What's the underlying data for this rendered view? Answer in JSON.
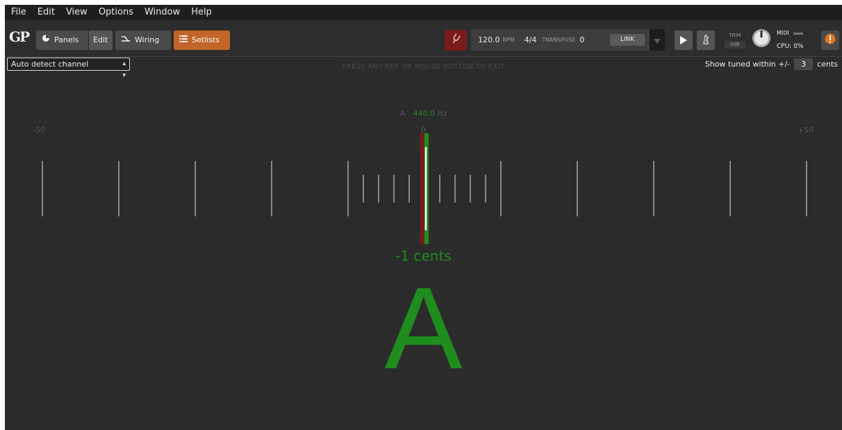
{
  "menu": [
    "File",
    "Edit",
    "View",
    "Options",
    "Window",
    "Help"
  ],
  "toolbar": {
    "logo_text": "GP",
    "panels_label": "Panels",
    "edit_label": "Edit",
    "wiring_label": "Wiring",
    "setlists_label": "Setlists",
    "bpm_value": "120.0",
    "bpm_unit": "BPM",
    "time_signature": "4/4",
    "transpose_label": "TRANSPOSE",
    "transpose_value": "0",
    "link_label": "LINK",
    "trim_label": "TRIM",
    "trim_value": "0dB",
    "midi_label": "MIDI",
    "cpu_label": "CPU: 0%"
  },
  "tuner": {
    "channel_select": "Auto detect channel",
    "exit_hint": "PRESS ANY KEY OR MOUSE BUTTON TO EXIT",
    "show_tuned_prefix": "Show tuned within +/-",
    "tolerance": "3",
    "show_tuned_suffix": "cents",
    "reference_note": "A",
    "reference_freq": "440.0",
    "reference_unit": "Hz",
    "scale_min_label": "-50",
    "scale_center_label": "0",
    "scale_max_label": "+50",
    "cents_readout": "-1 cents",
    "cents_offset": -1,
    "detected_note": "A"
  },
  "colors": {
    "accent_orange": "#c2652a",
    "in_tune_green": "#1e8c1e",
    "tuner_red": "#7a1b1b",
    "background": "#2b2b2b"
  }
}
